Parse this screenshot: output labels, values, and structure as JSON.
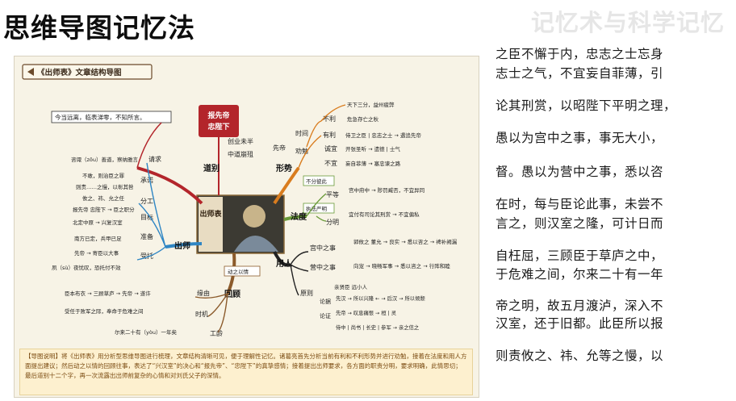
{
  "page": {
    "title": "思维导图记忆法",
    "watermark": "记忆术与科学记忆"
  },
  "mindmap": {
    "header": "《出师表》文章结构导图",
    "center_badge": "报先帝\n忠陛下",
    "portrait_caption": "出师表",
    "branches": {
      "daobie": "道别",
      "xingshi": "形势",
      "fadu": "法度",
      "yongren": "用人",
      "chushi": "出师",
      "huigu": "回顾"
    },
    "nodes": {
      "jin_dang": "今当远离，临表涕零，不知所言。",
      "chuangye": "创业未半",
      "zhongdao": "中道崩殂",
      "xiandi": "先帝",
      "shijian": "时间",
      "buli": "不利",
      "tianxia": "天下三分，益州疲弊",
      "weiji": "危急存亡之秋",
      "youli": "有利",
      "shiwei": "侍卫之臣 | 忠志之士 → 遇追先帝",
      "quanjian": "劝勉",
      "chengyi": "诚宜",
      "kaizhang": "开张圣听 → 遗德 | 士气",
      "buyi": "不宜",
      "wangzi": "妄自菲薄 → 塞忠谏之路",
      "bufen": "不分彼此",
      "pingdeng": "平等",
      "gongzhong": "宫中府中 → 陟罚臧否，不宜异同",
      "zhifa": "执法严明",
      "fenming": "分明",
      "yousi": "宜付有司论其刑赏 → 不宜偏私",
      "qingqiu": "请求",
      "zixun": "咨诹（zōu）善道，察纳雅言",
      "chengnuo": "承诺",
      "bugu": "不敢，则治臣之罪",
      "zeyou": "则责……之慢，以彰其咎",
      "fengong": "分工",
      "you_yi": "攸之、祎、允之任",
      "mubiao": "目标",
      "baoxiandi": "报先帝 忠陛下 → 臣之职分",
      "beiding": "北定中原 → 兴复汉室",
      "zhunbei": "准备",
      "nanfang": "南方已定，兵甲已足",
      "shoutuo": "受托",
      "xiandi_ji": "先帝 → 寄臣以大事",
      "suye": "夙（sù）夜忧叹，恐托付不效",
      "dongzhi": "动之以情",
      "yuanyou": "缘由",
      "chenben": "臣本布衣 → 三顾草庐 → 先帝 → 遂许",
      "shiji": "时机",
      "shouren": "受任于败军之际，奉命于危难之间",
      "gongling": "工龄",
      "erlai": "尔来二十有（yòu）一年矣",
      "gongzhong_shi": "宫中之事",
      "guoyun": "郭攸之 董允 → 良实 → 悉以咨之 → 裨补阙漏",
      "yingzhong": "营中之事",
      "xiangchong": "向宠 → 晓畅军事 → 悉以咨之 → 行阵和睦",
      "yuanze": "原则",
      "qinxian": "亲贤臣 远小人",
      "lunzheng": "论据",
      "xianhan": "先汉 → 所以兴隆 ← → 后汉 → 所以倾颓",
      "lunzheng2": "论证",
      "xiandi_lun": "先帝 → 叹息痛恨 → 桓 | 灵",
      "shizhong": "侍中 | 尚书 | 长史 | 参军 → 亲之信之"
    },
    "caption": "【导图说明】将《出师表》用分析型思维导图进行梳理，文章结构清晰可见，便于理解性记忆。诸葛亮首先分析当前有利和不利形势并进行劝勉，接着在法度和用人方面提出建议；然后动之以情的回顾往事，表达了“兴汉室”的决心和“报先帝”、“忠陛下”的真挚感情；接着提出出师要求，各方面的职责分明，要求明确，此情思切；最后道别十二个字，再一次流露出出师前复杂的心情和对刘氏父子的深情。"
  },
  "passage_lines": [
    "之臣不懈于内，忠志之士忘身",
    "志士之气，不宜妄自菲薄，引",
    "论其刑赏，以昭陛下平明之理，",
    "愚以为宫中之事，事无大小，",
    "督。愚以为营中之事，悉以咨",
    "在时，每与臣论此事，未尝不",
    "言之，则汉室之隆，可计日而",
    "自枉屈，三顾臣于草庐之中，",
    "于危难之间，尔来二十有一年",
    "帝之明，故五月渡泸，深入不",
    "汉室，还于旧都。此臣所以报",
    "则责攸之、祎、允等之慢，以"
  ],
  "colors": {
    "red_branch": "#b3252b",
    "blue_branch": "#2f86c4",
    "orange_branch": "#d97c1e",
    "black_branch": "#222222",
    "brown_branch": "#8b5a2b",
    "green_branch": "#6a9a3a",
    "paper": "#f7f3e6"
  }
}
